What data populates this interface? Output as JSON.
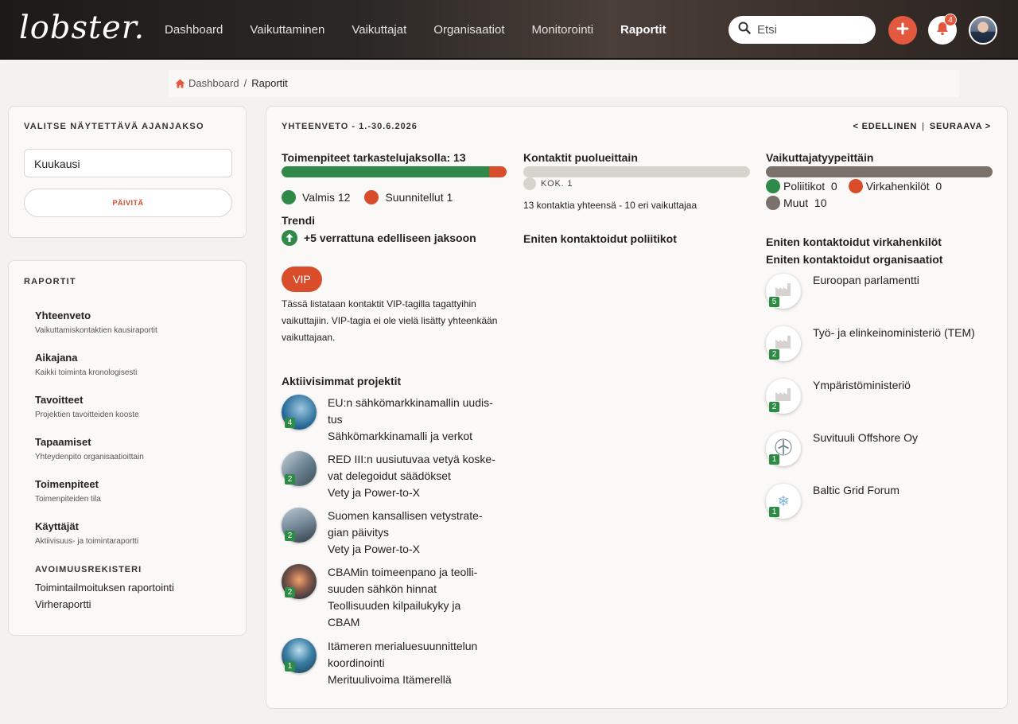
{
  "header": {
    "logo": "lobster.",
    "nav": [
      "Dashboard",
      "Vaikuttaminen",
      "Vaikuttajat",
      "Organisaatiot",
      "Monitorointi",
      "Raportit"
    ],
    "active_nav": "Raportit",
    "search_placeholder": "Etsi",
    "notification_count": "4"
  },
  "breadcrumb": {
    "home": "Dashboard",
    "separator": "/",
    "current": "Raportit"
  },
  "period": {
    "title": "VALITSE NÄYTETTÄVÄ AJANJAKSO",
    "selected": "Kuukausi",
    "refresh_label": "PÄIVITÄ"
  },
  "reports": {
    "title": "RAPORTIT",
    "items": [
      {
        "title": "Yhteenveto",
        "subtitle": "Vaikuttamiskontaktien kausiraportit"
      },
      {
        "title": "Aikajana",
        "subtitle": "Kaikki toiminta kronologisesti"
      },
      {
        "title": "Tavoitteet",
        "subtitle": "Projektien tavoitteiden kooste"
      },
      {
        "title": "Tapaamiset",
        "subtitle": "Yhteydenpito organisaatioittain"
      },
      {
        "title": "Toimenpiteet",
        "subtitle": "Toimenpiteiden tila"
      },
      {
        "title": "Käyttäjät",
        "subtitle": "Aktiivisuus- ja toimintaraportti"
      }
    ],
    "register_title": "AVOIMUUSREKISTERI",
    "register_links": [
      "Toimintailmoituksen raportointi",
      "Virheraportti"
    ]
  },
  "summary": {
    "title": "YHTEENVETO - 1.-30.6.2026",
    "prev": "< EDELLINEN",
    "pager_divider": "|",
    "next": "SEURAAVA >",
    "actions": {
      "heading": "Toimenpiteet tarkastelujaksolla: 13",
      "done_label": "Valmis",
      "done_value": 12,
      "planned_label": "Suunnitellut",
      "planned_value": 1,
      "trend_heading": "Trendi",
      "trend_text": "+5 verrattuna edelliseen jaksoon"
    },
    "vip": {
      "label": "VIP",
      "text": "Tässä listataan kontaktit VIP-tagilla tagattyihin vaikuttajiin. VIP-tagia ei ole vielä lisätty yhteenkään vaikuttajaan."
    },
    "projects_heading": "Aktiivisimmat projektit",
    "projects": [
      {
        "count": "4",
        "lines": [
          "EU:n sähkömarkkinamallin uudis-",
          "tus",
          "Sähkömarkkinamalli ja verkot"
        ]
      },
      {
        "count": "2",
        "lines": [
          "RED III:n uusiutuvaa vetyä koske-",
          "vat delegoidut säädökset",
          "Vety ja Power-to-X"
        ]
      },
      {
        "count": "2",
        "lines": [
          "Suomen kansallisen vetystrate-",
          "gian päivitys",
          "Vety ja Power-to-X"
        ]
      },
      {
        "count": "2",
        "lines": [
          "CBAMin toimeenpano ja teolli-",
          "suuden sähkön hinnat",
          "Teollisuuden kilpailukyky ja",
          "CBAM"
        ]
      },
      {
        "count": "1",
        "lines": [
          "Itämeren merialuesuunnittelun",
          "koordinointi",
          "Merituulivoima Itämerellä"
        ]
      }
    ],
    "party": {
      "heading": "Kontaktit puolueittain",
      "legend_label": "KOK.",
      "legend_value": 1,
      "total_text": "13 kontaktia yhteensä - 10 eri vaikuttajaa",
      "politicians_heading": "Eniten kontaktoidut poliitikot"
    },
    "types": {
      "heading": "Vaikuttajatyypeittäin",
      "politicians_label": "Poliitikot",
      "politicians_value": 0,
      "officials_label": "Virkahenkilöt",
      "officials_value": 0,
      "others_label": "Muut",
      "others_value": 10,
      "officials_heading": "Eniten kontaktoidut virkahenkilöt",
      "orgs_heading": "Eniten kontaktoidut organisaatiot"
    },
    "organizations": [
      {
        "count": "5",
        "name": "Euroopan parlamentti",
        "icon": "factory-icon"
      },
      {
        "count": "2",
        "name": "Työ- ja elinkeinoministeriö (TEM)",
        "icon": "factory-icon"
      },
      {
        "count": "2",
        "name": "Ympäristöministeriö",
        "icon": "factory-icon"
      },
      {
        "count": "1",
        "name": "Suvituuli Offshore Oy",
        "icon": "wind-turbine-icon"
      },
      {
        "count": "1",
        "name": "Baltic Grid Forum",
        "icon": "snowflake-icon"
      }
    ]
  },
  "colors": {
    "done": "#2f8a4a",
    "planned": "#d94d2b",
    "party_kok": "#d8d4cd",
    "others": "#7a716b",
    "accent": "#e2593f"
  }
}
